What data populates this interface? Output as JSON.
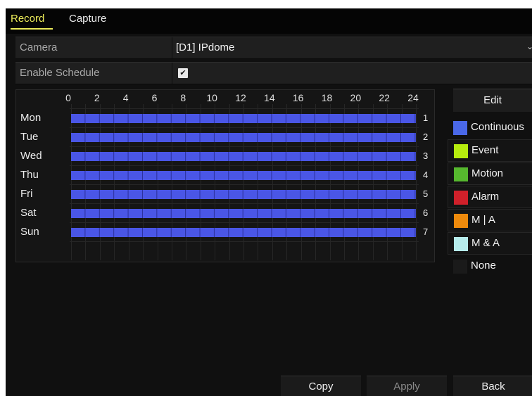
{
  "tabs": [
    {
      "label": "Record",
      "active": true
    },
    {
      "label": "Capture",
      "active": false
    }
  ],
  "camera": {
    "label": "Camera",
    "value": "[D1] IPdome"
  },
  "schedule": {
    "label": "Enable Schedule",
    "checked": true
  },
  "grid": {
    "hours": [
      "0",
      "2",
      "4",
      "6",
      "8",
      "10",
      "12",
      "14",
      "16",
      "18",
      "20",
      "22",
      "24"
    ],
    "days": [
      {
        "label": "Mon",
        "num": "1"
      },
      {
        "label": "Tue",
        "num": "2"
      },
      {
        "label": "Wed",
        "num": "3"
      },
      {
        "label": "Thu",
        "num": "4"
      },
      {
        "label": "Fri",
        "num": "5"
      },
      {
        "label": "Sat",
        "num": "6"
      },
      {
        "label": "Sun",
        "num": "7"
      }
    ],
    "recording_type": "Continuous",
    "recording_color": "#4a56e6"
  },
  "sidebar": {
    "edit_label": "Edit",
    "legend": [
      {
        "label": "Continuous",
        "color": "#4a68e8"
      },
      {
        "label": "Event",
        "color": "#b6ec0e"
      },
      {
        "label": "Motion",
        "color": "#56b82e"
      },
      {
        "label": "Alarm",
        "color": "#d0202a"
      },
      {
        "label": "M | A",
        "color": "#ee8a0c"
      },
      {
        "label": "M & A",
        "color": "#b6ecec"
      },
      {
        "label": "None",
        "color": "#1a1a1a"
      }
    ]
  },
  "buttons": {
    "copy": "Copy",
    "apply": "Apply",
    "back": "Back"
  }
}
